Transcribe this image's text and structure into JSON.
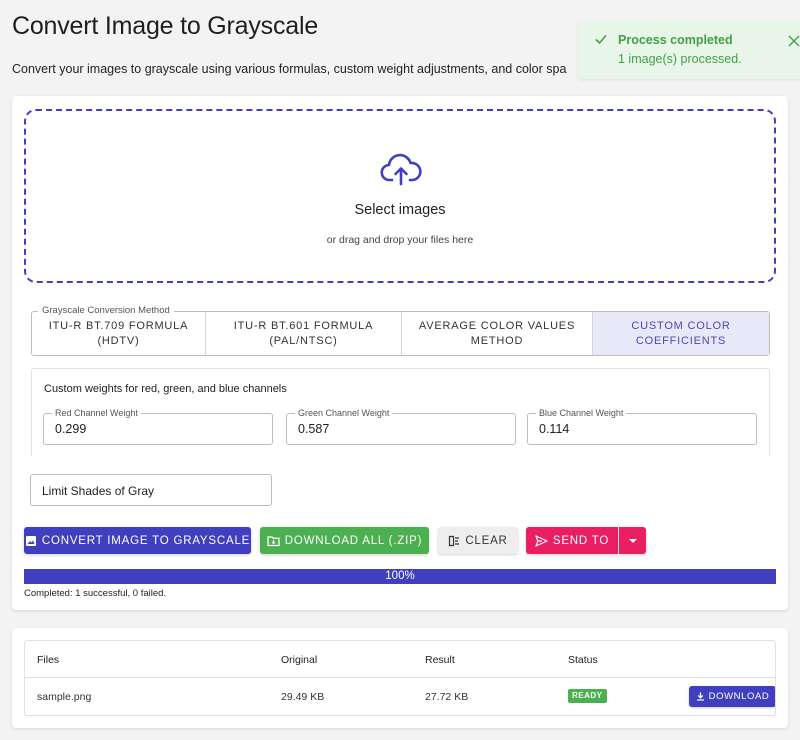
{
  "header": {
    "title": "Convert Image to Grayscale",
    "description": "Convert your images to grayscale using various formulas, custom weight adjustments, and color spa"
  },
  "toast": {
    "title": "Process completed",
    "message": "1 image(s) processed.",
    "icon": "check-icon",
    "color": "#43a047",
    "background": "#e8f5e9"
  },
  "dropzone": {
    "icon": "cloud-upload-icon",
    "title": "Select images",
    "subtitle": "or drag and drop your files here"
  },
  "method": {
    "legend": "Grayscale Conversion Method",
    "options": [
      {
        "line1": "ITU-R BT.709 Formula",
        "line2": "(HDTV)"
      },
      {
        "line1": "ITU-R BT.601 Formula",
        "line2": "(PAL/NTSC)"
      },
      {
        "line1": "Average Color Values",
        "line2": "Method"
      },
      {
        "line1": "Custom Color",
        "line2": "Coefficients"
      }
    ],
    "selected": "Custom Color Coefficients"
  },
  "weights": {
    "title": "Custom weights for red, green, and blue channels",
    "red": {
      "label": "Red Channel Weight",
      "value": "0.299"
    },
    "green": {
      "label": "Green Channel Weight",
      "value": "0.587"
    },
    "blue": {
      "label": "Blue Channel Weight",
      "value": "0.114"
    }
  },
  "limit": {
    "label": "Limit Shades of Gray"
  },
  "actions": {
    "convert": "Convert Image to Grayscale",
    "download_all": "Download All (.zip)",
    "clear": "Clear",
    "send_to": "Send To"
  },
  "progress": {
    "value": 1.0,
    "label": "100%",
    "status": "Completed: 1 successful, 0 failed."
  },
  "results": {
    "columns": [
      "Files",
      "Original",
      "Result",
      "Status"
    ],
    "rows": [
      {
        "file": "sample.png",
        "original": "29.49 KB",
        "result": "27.72 KB",
        "status": "READY",
        "action": "Download"
      }
    ]
  },
  "colors": {
    "primary": "#3f3fbf",
    "success": "#4caf50",
    "accent": "#e91e63"
  }
}
